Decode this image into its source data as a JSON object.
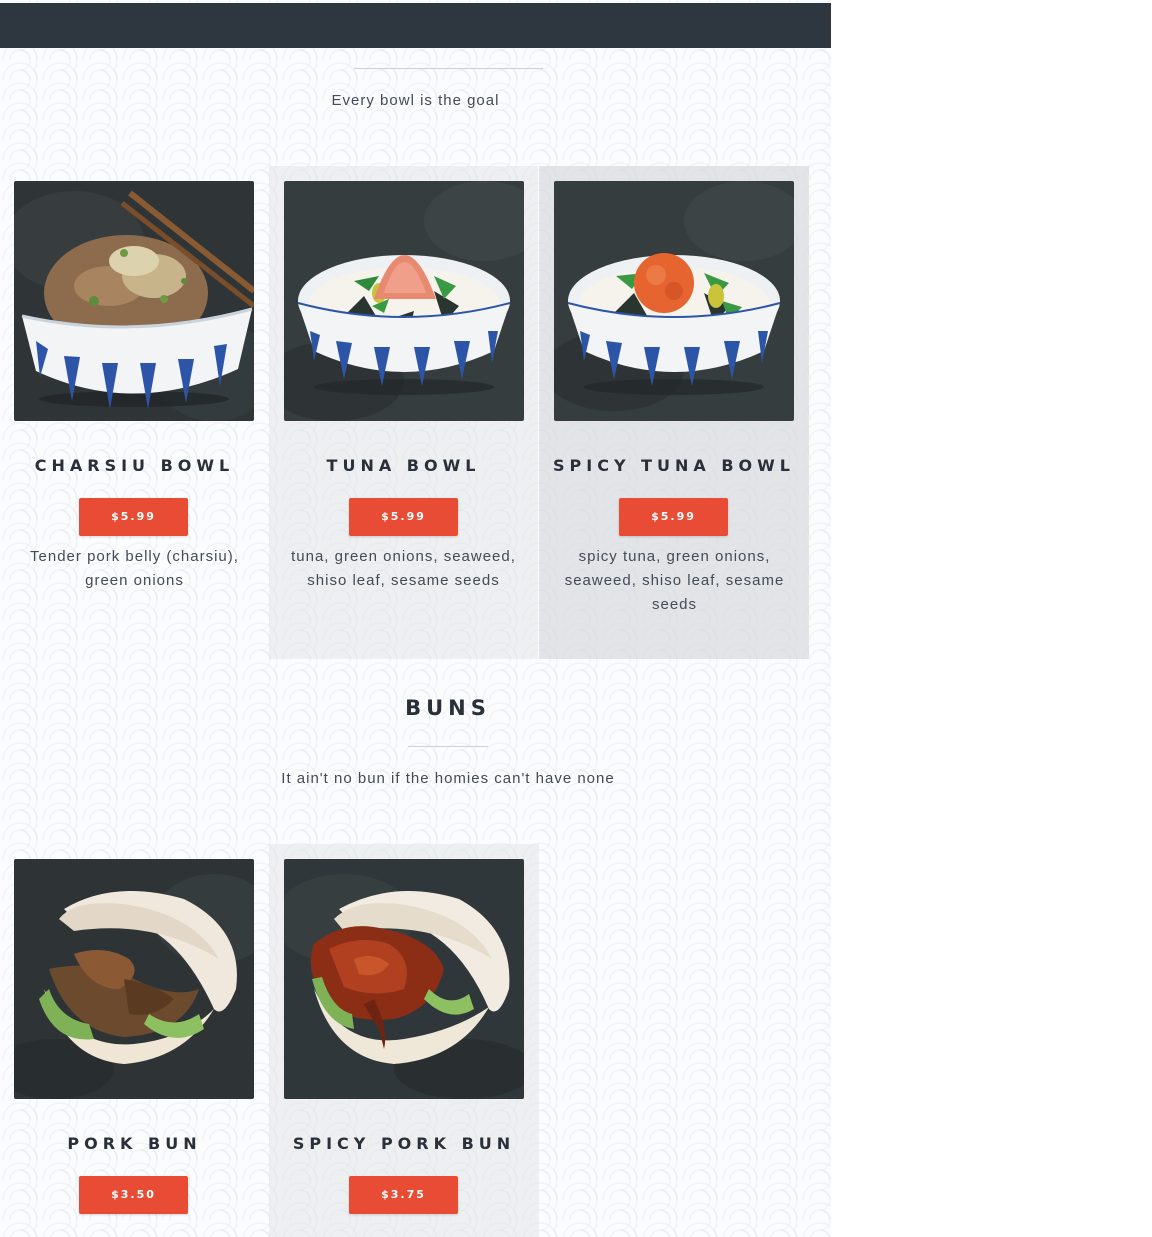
{
  "bowls": {
    "subtitle": "Every bowl is the goal",
    "items": [
      {
        "name": "CHARSIU BOWL",
        "price": "$5.99",
        "description": "Tender pork belly (charsiu), green onions"
      },
      {
        "name": "TUNA BOWL",
        "price": "$5.99",
        "description": "tuna, green onions, seaweed, shiso leaf, sesame seeds"
      },
      {
        "name": "SPICY TUNA BOWL",
        "price": "$5.99",
        "description": "spicy tuna, green onions, seaweed, shiso leaf, sesame seeds"
      }
    ]
  },
  "buns": {
    "title": "BUNS",
    "subtitle": "It ain't no bun if the homies can't have none",
    "items": [
      {
        "name": "PORK BUN",
        "price": "$3.50"
      },
      {
        "name": "SPICY PORK BUN",
        "price": "$3.75"
      }
    ]
  },
  "colors": {
    "topbar": "#2e3640",
    "price_button": "#e84c34",
    "title": "#2a3039"
  }
}
